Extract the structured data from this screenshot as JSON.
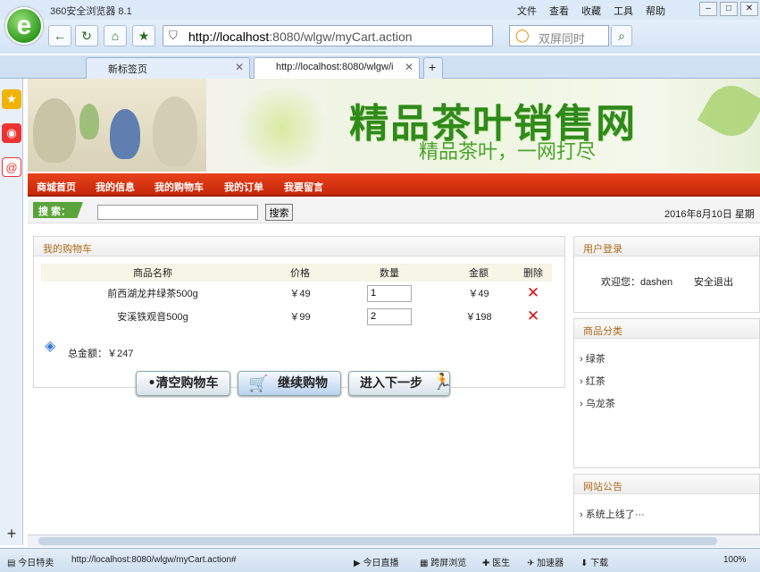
{
  "browser": {
    "title": "360安全浏览器 8.1",
    "menu": [
      "文件",
      "查看",
      "收藏",
      "工具",
      "帮助"
    ],
    "address_host": "http://localhost",
    "address_rest": ":8080/wlgw/myCart.action",
    "search_placeholder": "双屏同时",
    "tabs": [
      {
        "label": "新标签页"
      },
      {
        "label": "http://localhost:8080/wlgw/i"
      }
    ],
    "status_url": "http://localhost:8080/wlgw/myCart.action#",
    "status_left": "今日特卖",
    "status_items": [
      "今日直播",
      "跨屏浏览",
      "医生",
      "加速器",
      "下载"
    ],
    "zoom": "100%"
  },
  "site": {
    "title": "精品茶叶销售网",
    "slogan": "精品茶叶，一网打尽",
    "nav": [
      "商城首页",
      "我的信息",
      "我的购物车",
      "我的订单",
      "我要留言"
    ],
    "search_label": "搜 索：",
    "search_button": "搜索",
    "date": "2016年8月10日 星期"
  },
  "cart": {
    "heading": "我的购物车",
    "columns": [
      "商品名称",
      "价格",
      "数量",
      "金额",
      "删除"
    ],
    "rows": [
      {
        "name": "前西湖龙井绿茶500g",
        "price": "￥49",
        "qty": "1",
        "amount": "￥49"
      },
      {
        "name": "安溪铁观音500g",
        "price": "￥99",
        "qty": "2",
        "amount": "￥198"
      }
    ],
    "total": "总金额：￥247",
    "buttons": [
      "•清空购物车",
      "继续购物",
      "进入下一步"
    ]
  },
  "login": {
    "heading": "用户登录",
    "welcome": "欢迎您：dashen",
    "logout": "安全退出"
  },
  "categories": {
    "heading": "商品分类",
    "items": [
      "绿茶",
      "红茶",
      "乌龙茶"
    ]
  },
  "notice": {
    "heading": "网站公告",
    "items": [
      "系统上线了···"
    ]
  }
}
